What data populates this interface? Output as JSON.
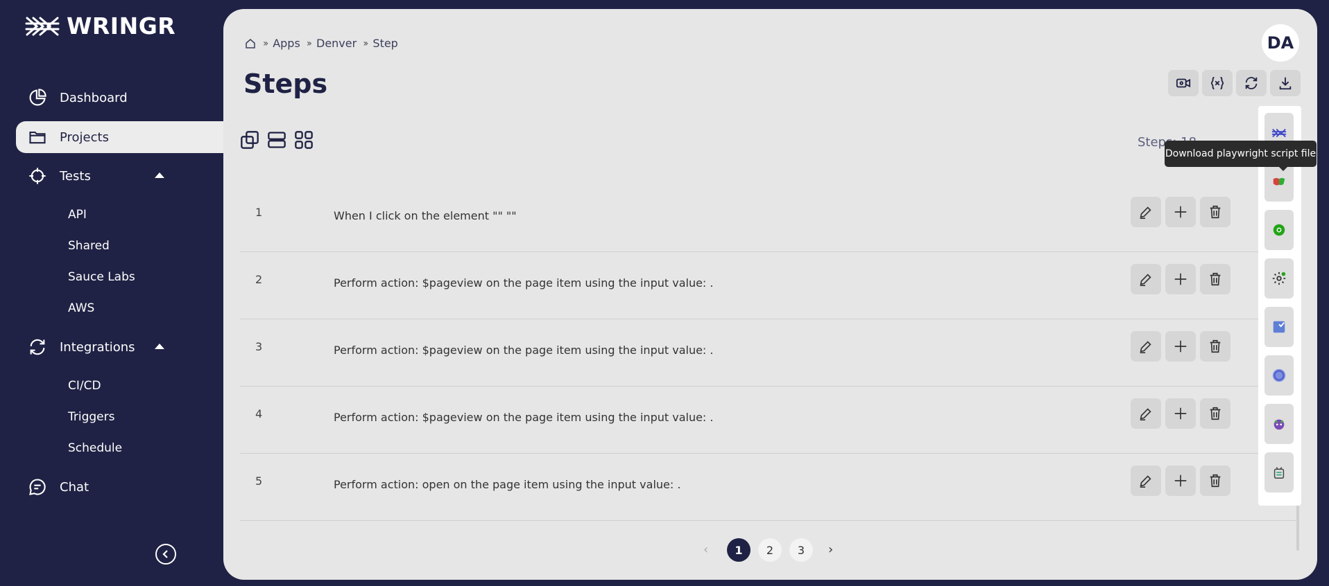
{
  "brand": {
    "name": "WRINGR"
  },
  "sidebar": {
    "items": [
      {
        "label": "Dashboard"
      },
      {
        "label": "Projects"
      },
      {
        "label": "Tests"
      },
      {
        "label": "Integrations"
      },
      {
        "label": "Chat"
      }
    ],
    "tests_sub": [
      "API",
      "Shared",
      "Sauce Labs",
      "AWS"
    ],
    "integrations_sub": [
      "CI/CD",
      "Triggers",
      "Schedule"
    ]
  },
  "header": {
    "breadcrumb": [
      "Apps",
      "Denver",
      "Step"
    ],
    "title": "Steps",
    "avatar": "DA",
    "steps_count": "Steps: 18"
  },
  "steps": [
    {
      "num": "1",
      "text": "When I click on the element \"\" \"\""
    },
    {
      "num": "2",
      "text": "Perform action: $pageview on the page item using the input value: ."
    },
    {
      "num": "3",
      "text": "Perform action: $pageview on the page item using the input value: ."
    },
    {
      "num": "4",
      "text": "Perform action: $pageview on the page item using the input value: ."
    },
    {
      "num": "5",
      "text": "Perform action: open on the page item using the input value: ."
    }
  ],
  "pagination": {
    "pages": [
      "1",
      "2",
      "3"
    ],
    "current": "1",
    "prev": "‹",
    "next": "›"
  },
  "tooltip": "Download playwright script file",
  "colors": {
    "sidebar_bg": "#1f2244",
    "panel_bg": "#e6e6e6",
    "button_bg": "#d6d6d6"
  }
}
